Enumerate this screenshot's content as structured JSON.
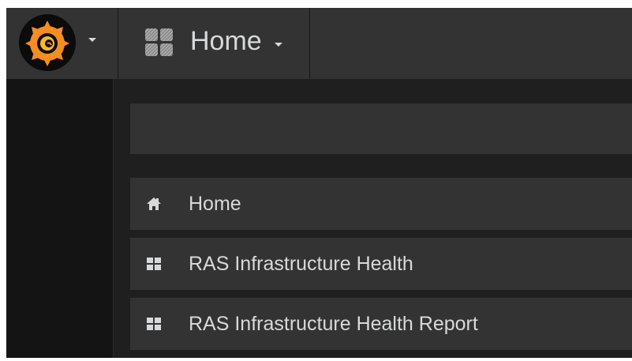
{
  "navbar": {
    "logo_icon": "grafana-logo-icon",
    "logo_menu_icon": "caret-down-icon",
    "dashboard_picker": {
      "icon": "dashboard-grid-icon",
      "label": "Home",
      "caret_icon": "caret-down-icon"
    }
  },
  "search": {
    "placeholder": "",
    "value": ""
  },
  "results": [
    {
      "icon": "home-icon",
      "label": "Home"
    },
    {
      "icon": "dashboard-icon",
      "label": "RAS Infrastructure Health"
    },
    {
      "icon": "dashboard-icon",
      "label": "RAS Infrastructure Health Report"
    }
  ],
  "colors": {
    "navbar_bg": "#333333",
    "page_bg": "#141414",
    "panel_bg": "#1f1f20",
    "row_bg": "#333333",
    "text": "#d8d9da",
    "logo_orange": "#f58d22",
    "logo_yellow": "#fcb828"
  }
}
